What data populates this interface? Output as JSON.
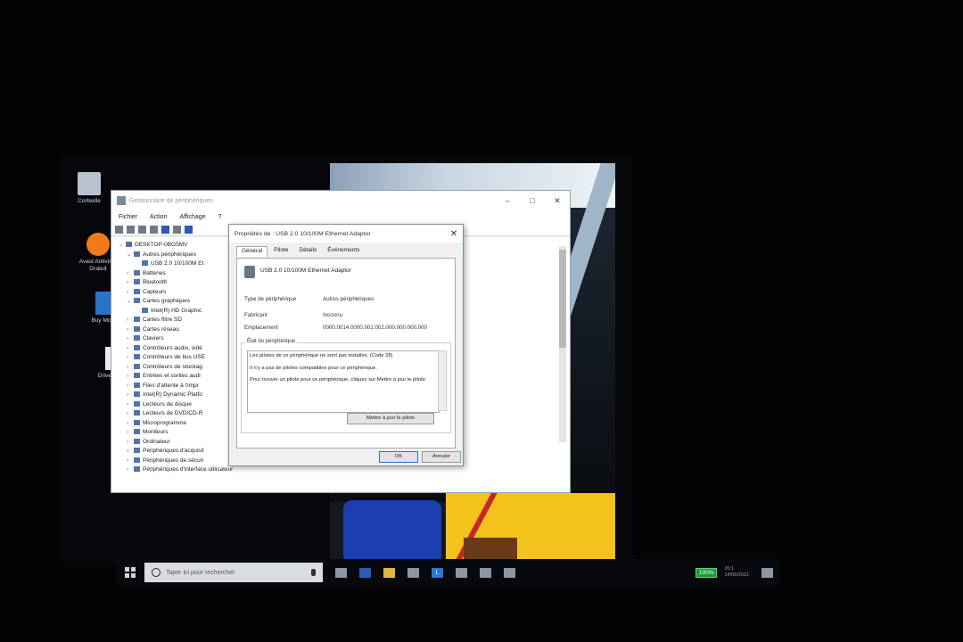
{
  "desktop": {
    "icons": [
      {
        "label": "Corbeille",
        "icon": "recycle-bin-icon"
      },
      {
        "label": "Avast Antivirus Gratuit",
        "icon": "avast-icon"
      },
      {
        "label": "Buy McAfee",
        "icon": "mcafee-icon"
      },
      {
        "label": "Driver Updat",
        "icon": "document-icon"
      }
    ]
  },
  "device_manager": {
    "title": "Gestionnaire de périphériques",
    "menu": [
      "Fichier",
      "Action",
      "Affichage",
      "?"
    ],
    "tree": [
      {
        "label": "DESKTOP-0BG5MV",
        "level": 0,
        "expanded": true
      },
      {
        "label": "Autres périphériques",
        "level": 1,
        "expanded": true
      },
      {
        "label": "USB 2.0 10/100M Et",
        "level": 2
      },
      {
        "label": "Batteries",
        "level": 1
      },
      {
        "label": "Bluetooth",
        "level": 1
      },
      {
        "label": "Capteurs",
        "level": 1
      },
      {
        "label": "Cartes graphiques",
        "level": 1,
        "expanded": true
      },
      {
        "label": "Intel(R) HD Graphic",
        "level": 2
      },
      {
        "label": "Cartes filtre SD",
        "level": 1
      },
      {
        "label": "Cartes réseau",
        "level": 1
      },
      {
        "label": "Claviers",
        "level": 1
      },
      {
        "label": "Contrôleurs audio, vidé",
        "level": 1
      },
      {
        "label": "Contrôleurs de bus USE",
        "level": 1
      },
      {
        "label": "Contrôleurs de stockag",
        "level": 1
      },
      {
        "label": "Entrées et sorties audi",
        "level": 1
      },
      {
        "label": "Files d'attente à l'impr",
        "level": 1
      },
      {
        "label": "Intel(R) Dynamic Platfo",
        "level": 1
      },
      {
        "label": "Lecteurs de disque",
        "level": 1
      },
      {
        "label": "Lecteurs de DVD/CD-R",
        "level": 1
      },
      {
        "label": "Microprogramme",
        "level": 1
      },
      {
        "label": "Moniteurs",
        "level": 1
      },
      {
        "label": "Ordinateur",
        "level": 1
      },
      {
        "label": "Périphériques d'acquisit",
        "level": 1
      },
      {
        "label": "Périphériques de sécuri",
        "level": 1
      },
      {
        "label": "Périphériques d'interface utilisateur",
        "level": 1
      }
    ]
  },
  "dialog": {
    "title": "Propriétés de : USB 2.0 10/100M Ethernet Adaptor",
    "tabs": [
      "Général",
      "Pilote",
      "Détails",
      "Événements"
    ],
    "active_tab": "Général",
    "device_name": "USB 2.0 10/100M Ethernet Adaptor",
    "fields": [
      {
        "label": "Type de périphérique",
        "value": "Autres périphériques"
      },
      {
        "label": "Fabricant",
        "value": "Inconnu"
      },
      {
        "label": "Emplacement",
        "value": "0000.0014.0000.002.002.000.000.000.000"
      }
    ],
    "status_group_label": "État du périphérique",
    "status_lines": [
      "Les pilotes de ce périphérique ne sont pas installés. (Code 28)",
      "Il n'y a pas de pilotes compatibles pour ce périphérique.",
      "Pour trouver un pilote pour ce périphérique, cliquez sur Mettre à jour le pilote."
    ],
    "update_button": "Mettre à jour le pilote",
    "ok_button": "OK",
    "cancel_button": "Annuler"
  },
  "taskbar": {
    "search_placeholder": "Taper ici pour rechercher",
    "battery": "100%",
    "clock_time": "20:1",
    "clock_date": "14/06/2021"
  }
}
